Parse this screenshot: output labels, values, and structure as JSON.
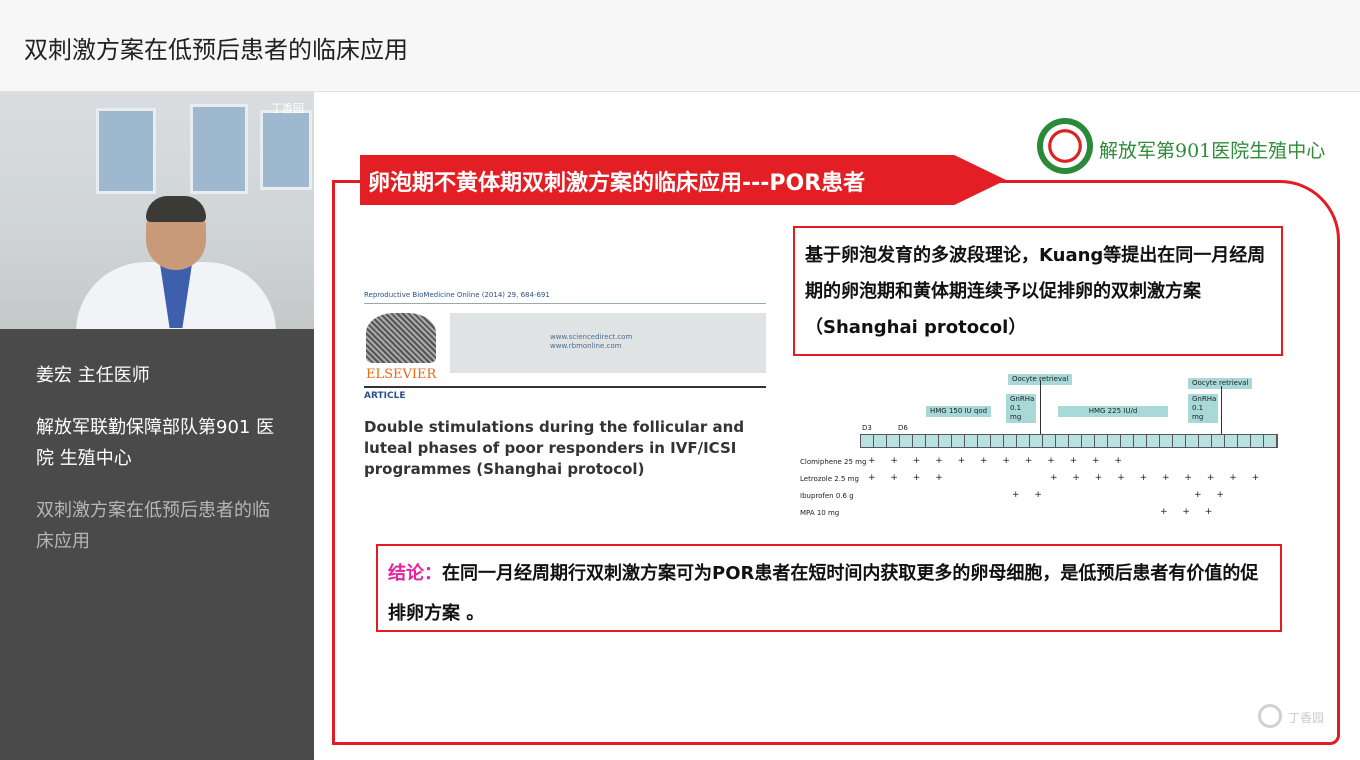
{
  "header": {
    "title": "双刺激方案在低预后患者的临床应用"
  },
  "video": {
    "logo_text": "丁香园"
  },
  "speaker": {
    "name": "姜宏  主任医师",
    "organization": "解放军联勤保障部队第901 医院  生殖中心",
    "topic": "双刺激方案在低预后患者的临床应用"
  },
  "slide": {
    "hospital_name": "解放军第901医院生殖中心",
    "banner_title": "卵泡期不黄体期双刺激方案的临床应用---POR患者",
    "paper": {
      "journal": "Reproductive BioMedicine Online (2014) 29, 684-691",
      "publisher": "ELSEVIER",
      "urls": "www.sciencedirect.com www.rbmonline.com",
      "section": "ARTICLE",
      "title": "Double stimulations during the follicular and luteal phases of poor responders in IVF/ICSI programmes (Shanghai protocol)"
    },
    "theory": "基于卵泡发育的多波段理论，Kuang等提出在同一月经周期的卵泡期和黄体期连续予以促排卵的双刺激方案（Shanghai protocol）",
    "timeline": {
      "labels": {
        "oocyte1": "Oocyte retrieval",
        "oocyte2": "Oocyte retrieval",
        "hmg1": "HMG 150 IU qod",
        "gnrha1": "GnRHa 0.1 mg",
        "hmg2": "HMG 225 IU/d",
        "gnrha2": "GnRHa 0.1 mg",
        "d3": "D3",
        "d6": "D6"
      },
      "drugs": [
        "Clomiphene 25 mg",
        "Letrozole 2.5 mg",
        "Ibuprofen 0.6 g",
        "MPA 10 mg"
      ],
      "plus_rows": [
        "+ + + + + + + + + + + +",
        "+ + + +",
        "+ + + + + + + + + +",
        "+ +",
        "+ +",
        "+ + +"
      ]
    },
    "conclusion_label": "结论：",
    "conclusion_text": "在同一月经周期行双刺激方案可为POR患者在短时间内获取更多的卵母细胞，是低预后患者有价值的促排卵方案 。"
  },
  "watermark": {
    "text": "丁香园"
  }
}
